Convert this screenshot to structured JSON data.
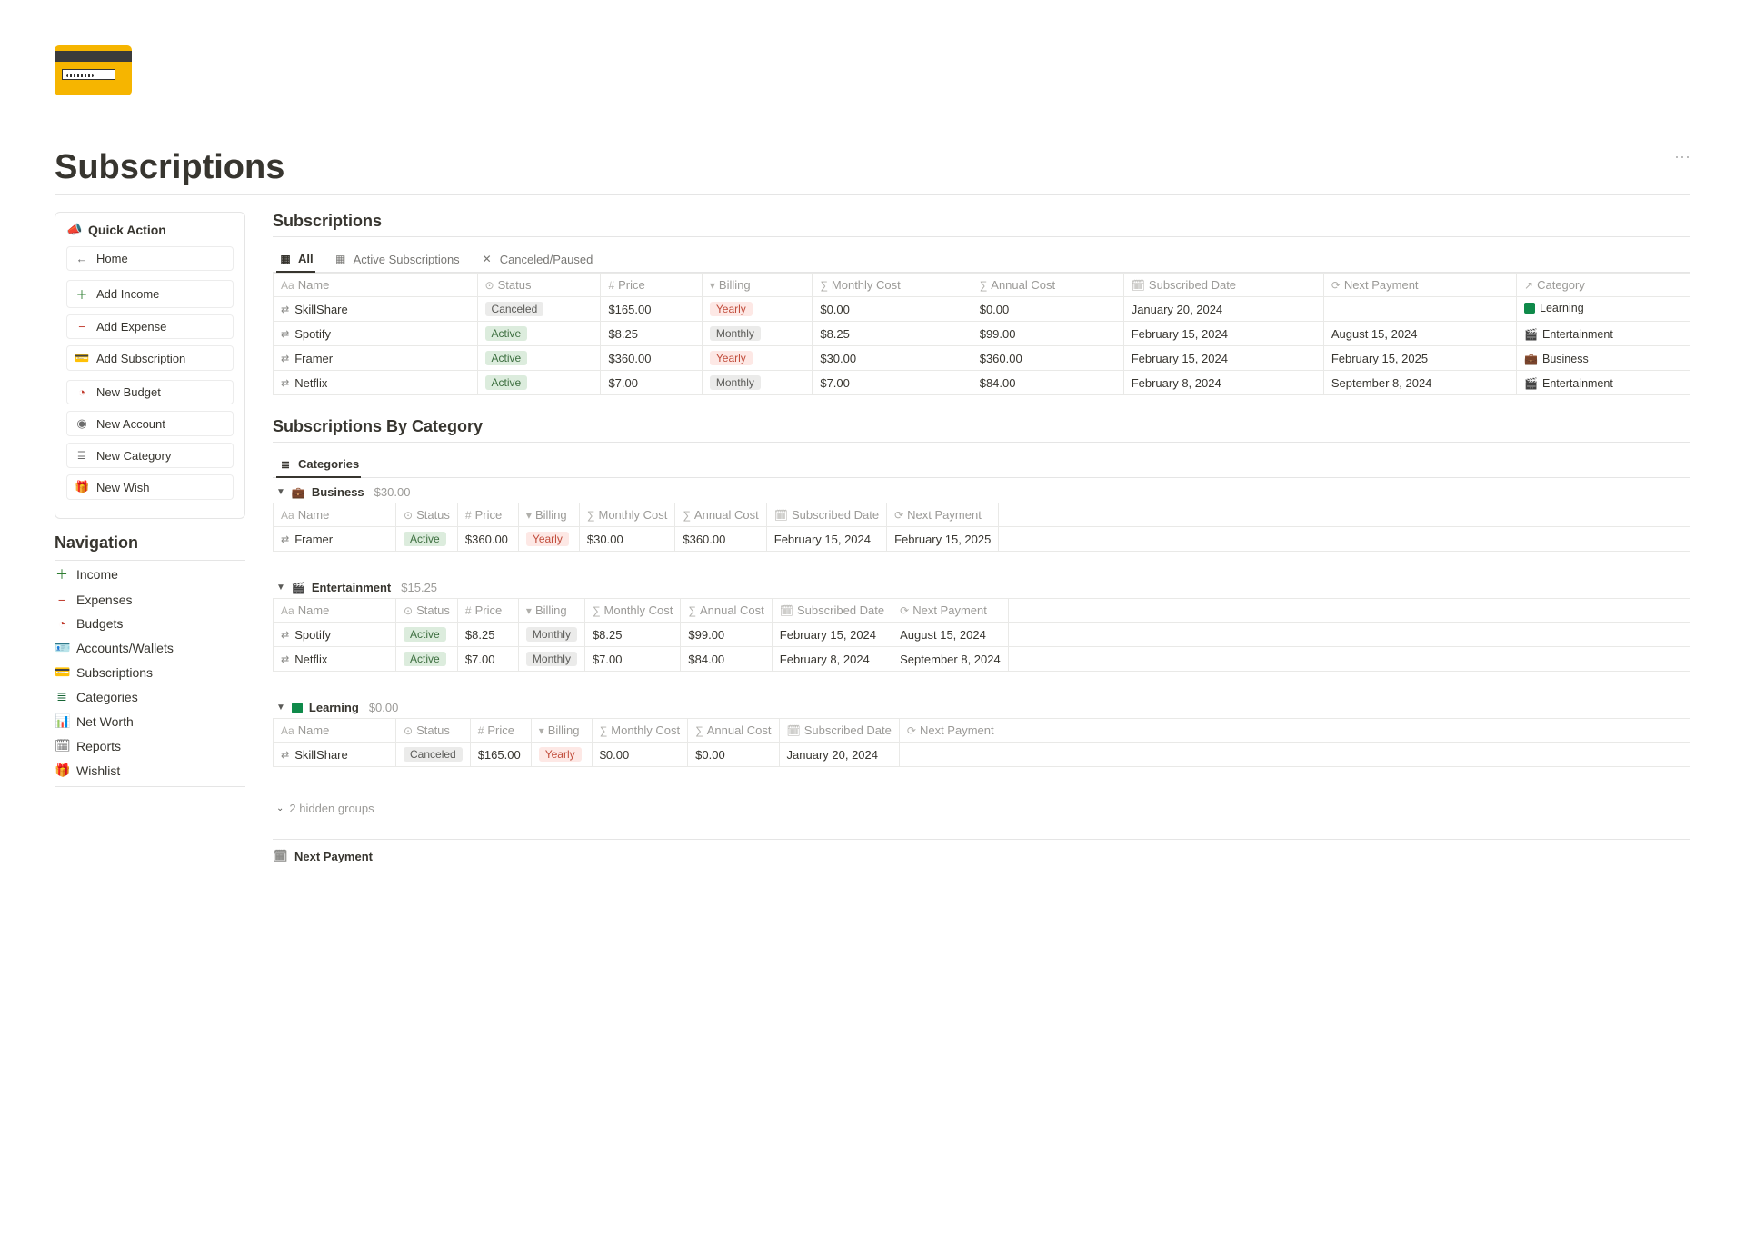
{
  "page": {
    "title": "Subscriptions"
  },
  "quick_action": {
    "heading": "Quick Action",
    "home": "Home",
    "add_income": "Add Income",
    "add_expense": "Add Expense",
    "add_subscription": "Add Subscription",
    "new_budget": "New Budget",
    "new_account": "New Account",
    "new_category": "New Category",
    "new_wish": "New Wish"
  },
  "navigation": {
    "heading": "Navigation",
    "items": [
      {
        "label": "Income"
      },
      {
        "label": "Expenses"
      },
      {
        "label": "Budgets"
      },
      {
        "label": "Accounts/Wallets"
      },
      {
        "label": "Subscriptions"
      },
      {
        "label": "Categories"
      },
      {
        "label": "Net Worth"
      },
      {
        "label": "Reports"
      },
      {
        "label": "Wishlist"
      }
    ]
  },
  "subscriptions": {
    "heading": "Subscriptions",
    "tabs": {
      "all": "All",
      "active": "Active Subscriptions",
      "canceled": "Canceled/Paused"
    },
    "columns": {
      "name": "Name",
      "status": "Status",
      "price": "Price",
      "billing": "Billing",
      "monthly": "Monthly Cost",
      "annual": "Annual Cost",
      "subdate": "Subscribed Date",
      "next": "Next Payment",
      "category": "Category"
    },
    "rows": [
      {
        "name": "SkillShare",
        "status": "Canceled",
        "price": "$165.00",
        "billing": "Yearly",
        "monthly": "$0.00",
        "annual": "$0.00",
        "subdate": "January 20, 2024",
        "next": "",
        "category": "Learning"
      },
      {
        "name": "Spotify",
        "status": "Active",
        "price": "$8.25",
        "billing": "Monthly",
        "monthly": "$8.25",
        "annual": "$99.00",
        "subdate": "February 15, 2024",
        "next": "August 15, 2024",
        "category": "Entertainment"
      },
      {
        "name": "Framer",
        "status": "Active",
        "price": "$360.00",
        "billing": "Yearly",
        "monthly": "$30.00",
        "annual": "$360.00",
        "subdate": "February 15, 2024",
        "next": "February 15, 2025",
        "category": "Business"
      },
      {
        "name": "Netflix",
        "status": "Active",
        "price": "$7.00",
        "billing": "Monthly",
        "monthly": "$7.00",
        "annual": "$84.00",
        "subdate": "February 8, 2024",
        "next": "September 8, 2024",
        "category": "Entertainment"
      }
    ]
  },
  "by_category": {
    "heading": "Subscriptions By Category",
    "view_label": "Categories",
    "columns": {
      "name": "Name",
      "status": "Status",
      "price": "Price",
      "billing": "Billing",
      "monthly": "Monthly Cost",
      "annual": "Annual Cost",
      "subdate": "Subscribed Date",
      "next": "Next Payment"
    },
    "groups": [
      {
        "name": "Business",
        "sum": "$30.00",
        "rows": [
          {
            "name": "Framer",
            "status": "Active",
            "price": "$360.00",
            "billing": "Yearly",
            "monthly": "$30.00",
            "annual": "$360.00",
            "subdate": "February 15, 2024",
            "next": "February 15, 2025"
          }
        ]
      },
      {
        "name": "Entertainment",
        "sum": "$15.25",
        "rows": [
          {
            "name": "Spotify",
            "status": "Active",
            "price": "$8.25",
            "billing": "Monthly",
            "monthly": "$8.25",
            "annual": "$99.00",
            "subdate": "February 15, 2024",
            "next": "August 15, 2024"
          },
          {
            "name": "Netflix",
            "status": "Active",
            "price": "$7.00",
            "billing": "Monthly",
            "monthly": "$7.00",
            "annual": "$84.00",
            "subdate": "February 8, 2024",
            "next": "September 8, 2024"
          }
        ]
      },
      {
        "name": "Learning",
        "sum": "$0.00",
        "rows": [
          {
            "name": "SkillShare",
            "status": "Canceled",
            "price": "$165.00",
            "billing": "Yearly",
            "monthly": "$0.00",
            "annual": "$0.00",
            "subdate": "January 20, 2024",
            "next": ""
          }
        ]
      }
    ],
    "hidden_groups": "2 hidden groups",
    "next_payment_view": "Next Payment"
  }
}
